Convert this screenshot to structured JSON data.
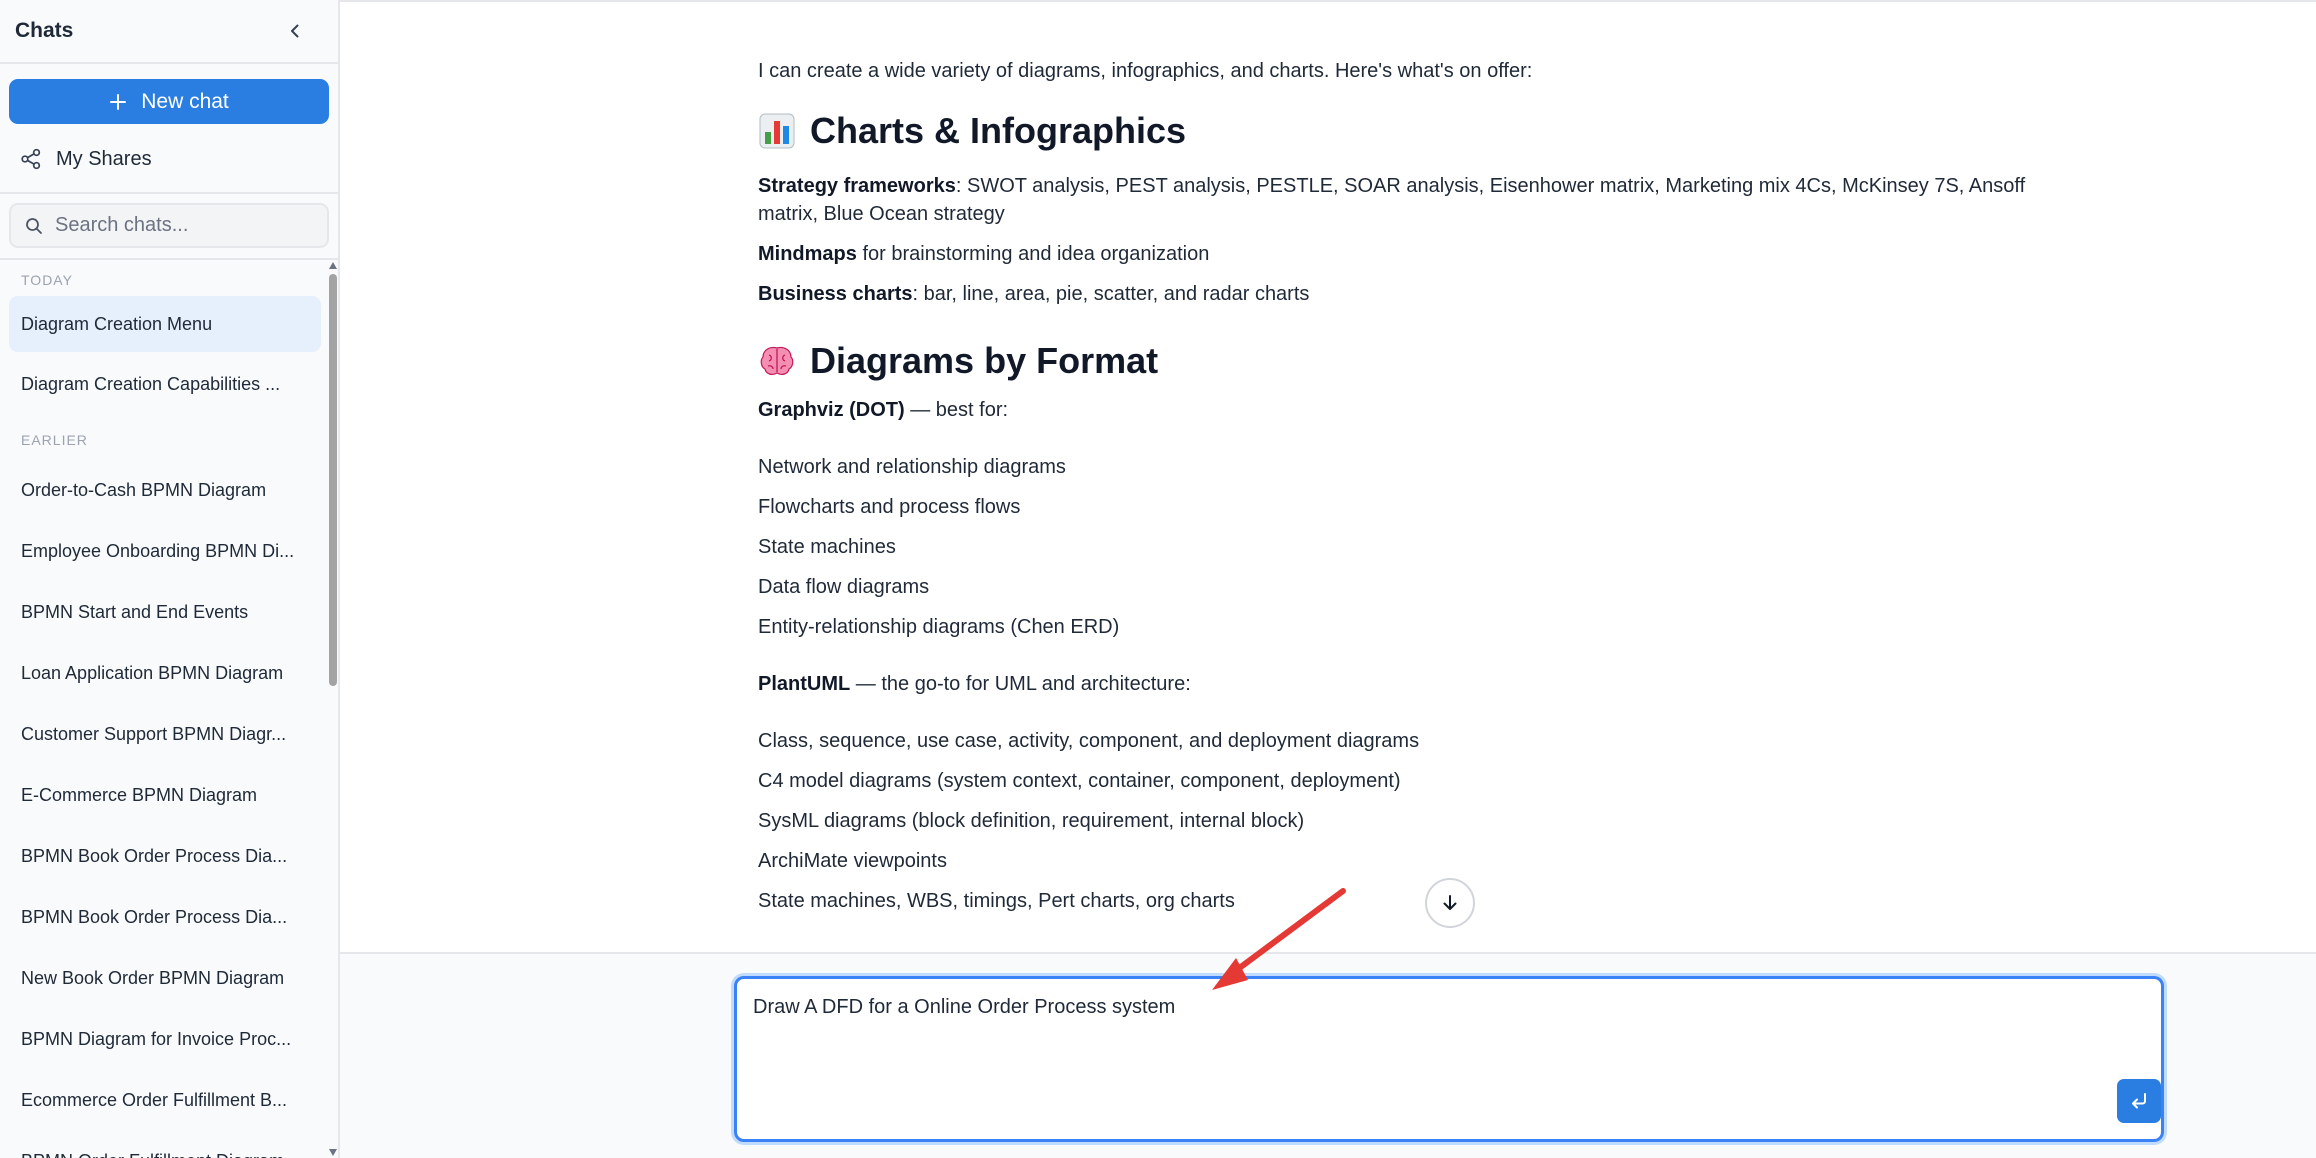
{
  "sidebar": {
    "title": "Chats",
    "new_chat_label": "New chat",
    "my_shares_label": "My Shares",
    "search_placeholder": "Search chats...",
    "groups": [
      {
        "label": "TODAY",
        "items": [
          {
            "label": "Diagram Creation Menu",
            "active": true
          },
          {
            "label": "Diagram Creation Capabilities ..."
          }
        ]
      },
      {
        "label": "EARLIER",
        "items": [
          {
            "label": "Order-to-Cash BPMN Diagram"
          },
          {
            "label": "Employee Onboarding BPMN Di..."
          },
          {
            "label": "BPMN Start and End Events"
          },
          {
            "label": "Loan Application BPMN Diagram"
          },
          {
            "label": "Customer Support BPMN Diagr..."
          },
          {
            "label": "E-Commerce BPMN Diagram"
          },
          {
            "label": "BPMN Book Order Process Dia..."
          },
          {
            "label": "BPMN Book Order Process Dia..."
          },
          {
            "label": "New Book Order BPMN Diagram"
          },
          {
            "label": "BPMN Diagram for Invoice Proc..."
          },
          {
            "label": "Ecommerce Order Fulfillment B..."
          },
          {
            "label": "BPMN Order Fulfillment Diagram"
          }
        ]
      }
    ]
  },
  "message": {
    "intro": "I can create a wide variety of diagrams, infographics, and charts. Here's what's on offer:",
    "section1": {
      "icon": "bar-chart-emoji",
      "heading": "Charts & Infographics",
      "lines": [
        {
          "bold": "Strategy frameworks",
          "text": ": SWOT analysis, PEST analysis, PESTLE, SOAR analysis, Eisenhower matrix, Marketing mix 4Cs, McKinsey 7S, Ansoff matrix, Blue Ocean strategy"
        },
        {
          "bold": "Mindmaps",
          "text": " for brainstorming and idea organization"
        },
        {
          "bold": "Business charts",
          "text": ": bar, line, area, pie, scatter, and radar charts"
        }
      ]
    },
    "section2": {
      "icon": "brain-emoji",
      "heading": "Diagrams by Format",
      "graphviz": {
        "bold": "Graphviz (DOT)",
        "text": " — best for:",
        "items": [
          "Network and relationship diagrams",
          "Flowcharts and process flows",
          "State machines",
          "Data flow diagrams",
          "Entity-relationship diagrams (Chen ERD)"
        ]
      },
      "plantuml": {
        "bold": "PlantUML",
        "text": " — the go-to for UML and architecture:",
        "items": [
          "Class, sequence, use case, activity, component, and deployment diagrams",
          "C4 model diagrams (system context, container, component, deployment)",
          "SysML diagrams (block definition, requirement, internal block)",
          "ArchiMate viewpoints",
          "State machines, WBS, timings, Pert charts, org charts"
        ]
      }
    }
  },
  "composer": {
    "value": "Draw A DFD for a Online Order Process system"
  },
  "colors": {
    "accent": "#2a7de1",
    "annotation_arrow": "#e53935"
  }
}
